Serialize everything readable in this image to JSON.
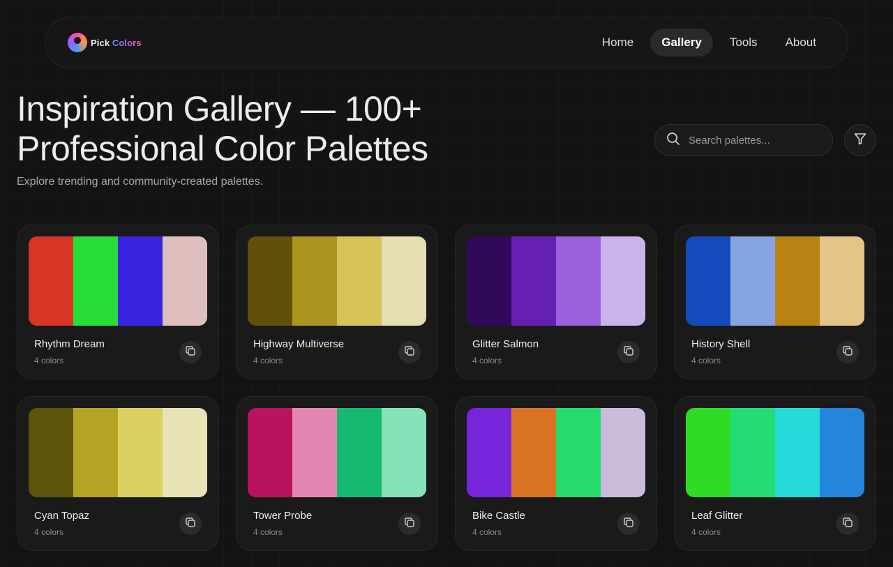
{
  "brand": {
    "part1": "Pick ",
    "part2": "Colors"
  },
  "nav": [
    {
      "label": "Home",
      "active": false
    },
    {
      "label": "Gallery",
      "active": true
    },
    {
      "label": "Tools",
      "active": false
    },
    {
      "label": "About",
      "active": false
    }
  ],
  "hero": {
    "title": "Inspiration Gallery — 100+ Professional Color Palettes",
    "subtitle": "Explore trending and community-created palettes."
  },
  "search": {
    "placeholder": "Search palettes...",
    "value": ""
  },
  "icons": {
    "search": "search-icon",
    "filter": "filter-icon",
    "copy": "copy-icon",
    "logo": "logo-icon"
  },
  "palettes": [
    {
      "name": "Rhythm Dream",
      "count": "4 colors",
      "colors": [
        "#d93426",
        "#27dd38",
        "#3a24df",
        "#dfbfbd"
      ]
    },
    {
      "name": "Highway Multiverse",
      "count": "4 colors",
      "colors": [
        "#624f09",
        "#ad931f",
        "#d7c25a",
        "#e7ddb3"
      ]
    },
    {
      "name": "Glitter Salmon",
      "count": "4 colors",
      "colors": [
        "#31095b",
        "#6520b3",
        "#9b5fdb",
        "#ccb2ea"
      ]
    },
    {
      "name": "History Shell",
      "count": "4 colors",
      "colors": [
        "#154abc",
        "#85a5e2",
        "#b98314",
        "#e4c587"
      ]
    },
    {
      "name": "Cyan Topaz",
      "count": "4 colors",
      "colors": [
        "#5c5409",
        "#b3a423",
        "#d9d060",
        "#e7e3b5"
      ]
    },
    {
      "name": "Tower Probe",
      "count": "4 colors",
      "colors": [
        "#ba135d",
        "#e187b1",
        "#17b870",
        "#87e1b9"
      ]
    },
    {
      "name": "Bike Castle",
      "count": "4 colors",
      "colors": [
        "#7724dd",
        "#da7424",
        "#27da6e",
        "#cabddb"
      ]
    },
    {
      "name": "Leaf Glitter",
      "count": "4 colors",
      "colors": [
        "#2fdb25",
        "#25db74",
        "#25dbd9",
        "#2584db"
      ]
    }
  ]
}
